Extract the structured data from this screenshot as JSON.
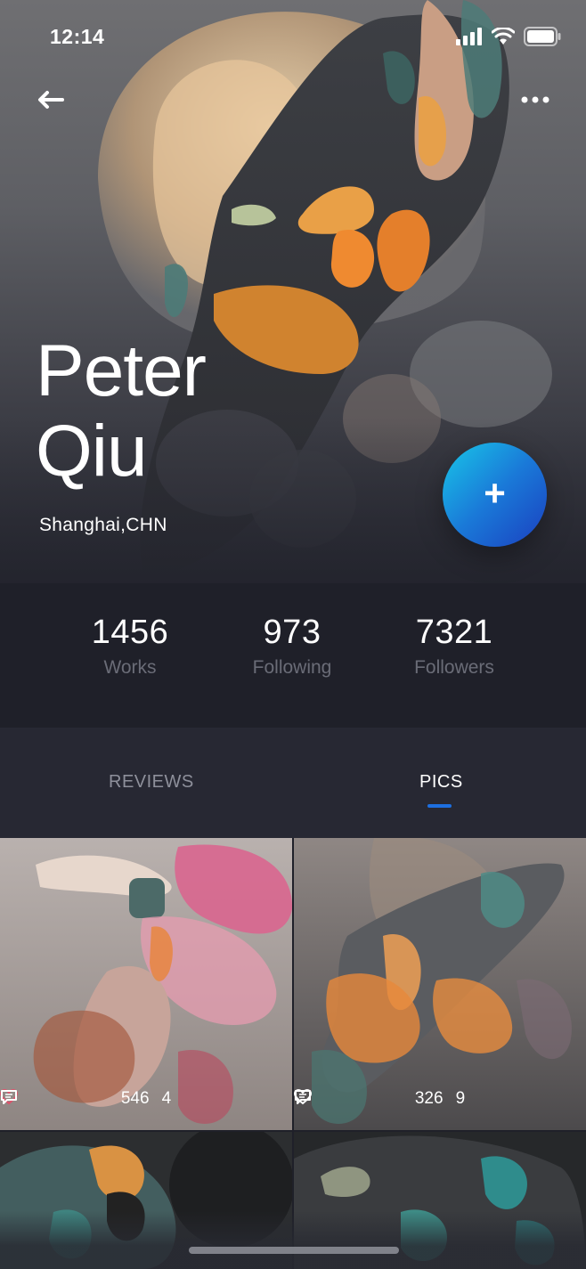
{
  "status_bar": {
    "time": "12:14"
  },
  "profile": {
    "first_name": "Peter",
    "last_name": "Qiu",
    "location": "Shanghai,CHN"
  },
  "actions": {
    "follow_icon": "plus"
  },
  "stats": [
    {
      "value": "1456",
      "label": "Works"
    },
    {
      "value": "973",
      "label": "Following"
    },
    {
      "value": "7321",
      "label": "Followers"
    }
  ],
  "tabs": [
    {
      "label": "REVIEWS",
      "active": false
    },
    {
      "label": "PICS",
      "active": true
    }
  ],
  "posts": [
    {
      "likes": "546",
      "comments": "4",
      "liked": true
    },
    {
      "likes": "326",
      "comments": "9",
      "liked": false
    }
  ],
  "colors": {
    "accent": "#1d6fe0",
    "fab_start": "#18c7e8",
    "fab_end": "#1b3fbf",
    "like": "#e0506a"
  }
}
